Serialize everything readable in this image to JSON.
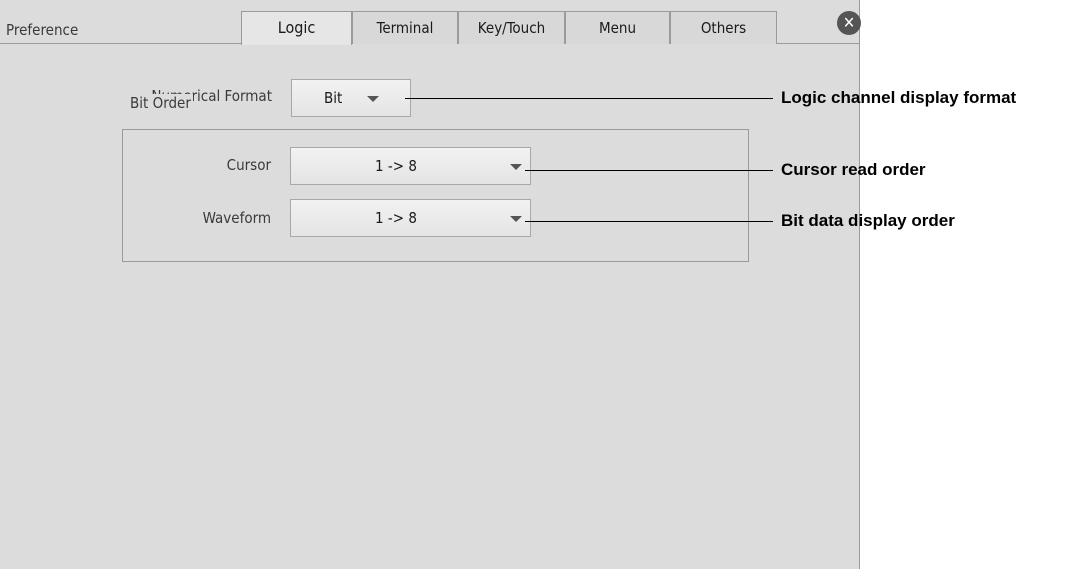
{
  "window": {
    "title": "Preference",
    "close_icon": "close-icon"
  },
  "tabs": [
    {
      "label": "Logic",
      "active": true
    },
    {
      "label": "Terminal",
      "active": false
    },
    {
      "label": "Key/Touch",
      "active": false
    },
    {
      "label": "Menu",
      "active": false
    },
    {
      "label": "Others",
      "active": false
    }
  ],
  "numerical_format": {
    "label": "Numerical Format",
    "value": "Bit"
  },
  "bit_order": {
    "legend": "Bit Order",
    "cursor": {
      "label": "Cursor",
      "value": "1 -> 8"
    },
    "waveform": {
      "label": "Waveform",
      "value": "1 -> 8"
    }
  },
  "annotations": {
    "numerical_format": "Logic channel display format",
    "cursor": "Cursor read order",
    "waveform": "Bit data display order"
  }
}
